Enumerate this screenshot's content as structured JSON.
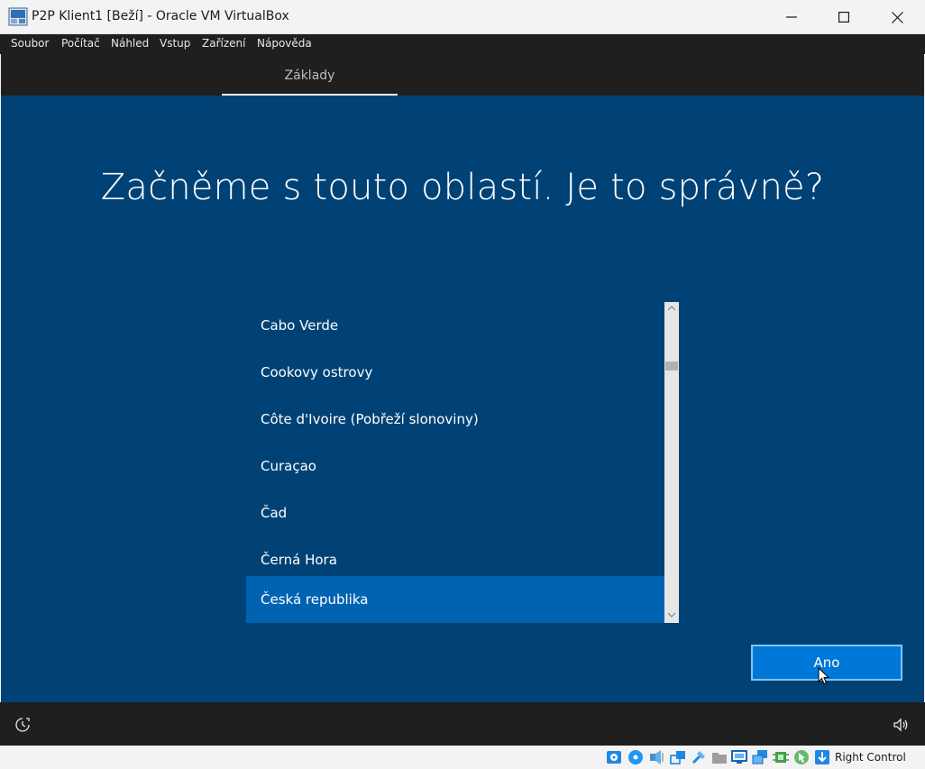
{
  "window": {
    "title": "P2P Klient1 [Beží] - Oracle VM VirtualBox",
    "controls": [
      "minimize-icon",
      "maximize-icon",
      "close-icon"
    ]
  },
  "menubar": {
    "items": [
      "Soubor",
      "Počítač",
      "Náhled",
      "Vstup",
      "Zařízení",
      "Nápověda"
    ]
  },
  "oobe": {
    "tab_label": "Základy",
    "headline": "Začněme s touto oblastí. Je to správně?",
    "regions": [
      "Cabo Verde",
      "Cookovy ostrovy",
      "Côte d'Ivoire (Pobřeží slonoviny)",
      "Curaçao",
      "Čad",
      "Černá Hora",
      "Česká republika"
    ],
    "selected_region": "Česká republika",
    "confirm_button": "Ano",
    "colors": {
      "background": "#004275",
      "selected": "#0063b1",
      "button": "#0078d7",
      "chrome": "#1f1f1f"
    }
  },
  "statusbar": {
    "host_key": "Right Control",
    "icons": [
      "hard-disk-icon",
      "optical-drive-icon",
      "audio-icon",
      "network-icon",
      "usb-icon",
      "shared-folders-icon",
      "display-icon",
      "recording-icon",
      "cpu-icon",
      "mouse-integration-icon",
      "keyboard-capture-icon"
    ]
  }
}
